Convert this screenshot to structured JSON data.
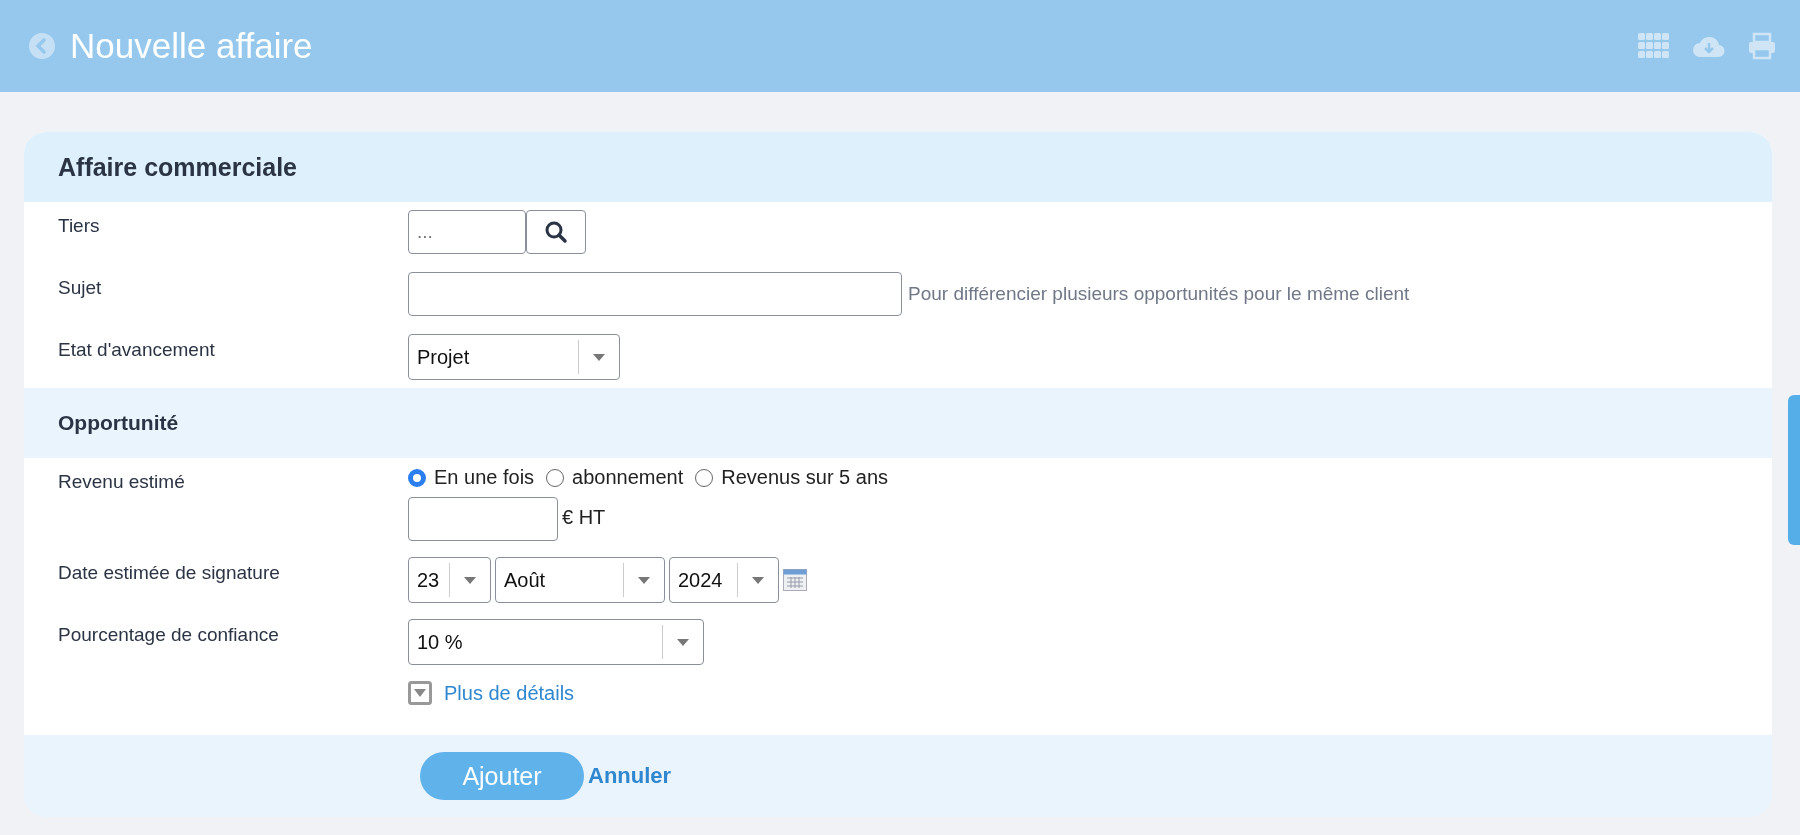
{
  "header": {
    "title": "Nouvelle affaire"
  },
  "sections": [
    {
      "title": "Affaire commerciale",
      "rows": [
        {
          "kind": "lookup",
          "label": "Tiers",
          "placeholder": "..."
        },
        {
          "kind": "text",
          "label": "Sujet",
          "hint": "Pour différencier plusieurs opportunités pour le même client"
        },
        {
          "kind": "select",
          "label": "Etat d'avancement",
          "value": "Projet"
        }
      ]
    },
    {
      "title": "Opportunité",
      "rows": [
        {
          "kind": "revenue",
          "label": "Revenu estimé",
          "options": [
            {
              "label": "En une fois",
              "selected": true
            },
            {
              "label": "abonnement",
              "selected": false
            },
            {
              "label": "Revenus sur 5 ans",
              "selected": false
            }
          ],
          "unit": "€ HT"
        },
        {
          "kind": "date",
          "label": "Date estimée de signature",
          "day": "23",
          "month": "Août",
          "year": "2024"
        },
        {
          "kind": "select-wide",
          "label": "Pourcentage de confiance",
          "value": "10 %"
        },
        {
          "kind": "more",
          "link": "Plus de détails"
        }
      ]
    }
  ],
  "actions": {
    "submit": "Ajouter",
    "cancel": "Annuler"
  }
}
